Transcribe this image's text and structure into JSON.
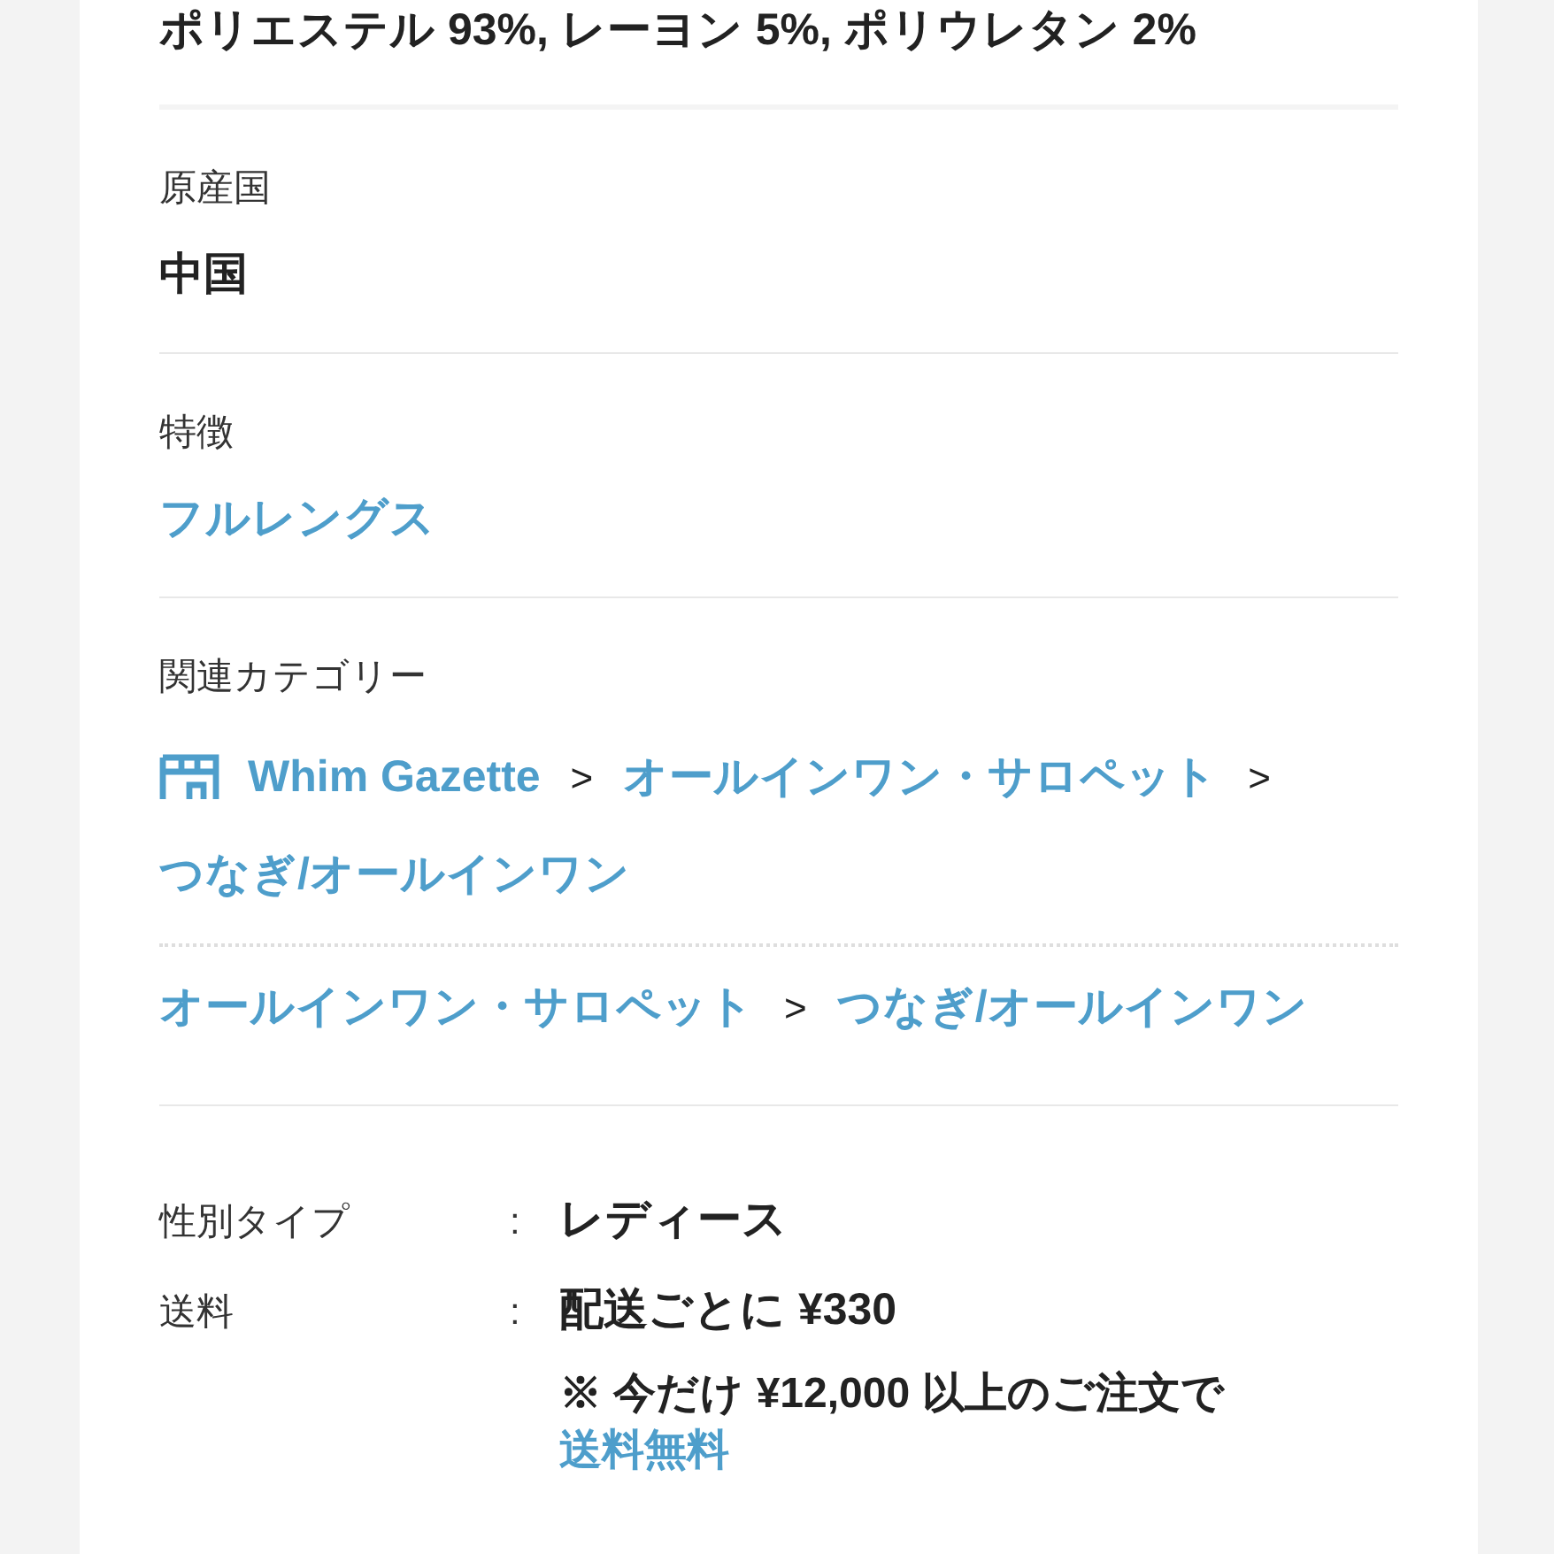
{
  "sections": [
    {
      "kind": "text",
      "value": "ポリエステル 93%, レーヨン 5%, ポリウレタン 2%"
    },
    {
      "kind": "text",
      "label": "原産国",
      "value": "中国"
    },
    {
      "kind": "link",
      "label": "特徴",
      "value": "フルレングス"
    },
    {
      "kind": "categories",
      "label": "関連カテゴリー",
      "paths": [
        {
          "items": [
            {
              "kind": "store",
              "label": "Whim Gazette"
            },
            {
              "kind": "separator",
              "label": ">"
            },
            {
              "kind": "category",
              "label": "オールインワン・サロペット"
            },
            {
              "kind": "separator",
              "label": ">"
            },
            {
              "kind": "category",
              "label": "つなぎ/オールインワン"
            }
          ]
        },
        {
          "items": [
            {
              "kind": "category",
              "label": "オールインワン・サロペット"
            },
            {
              "kind": "separator",
              "label": ">"
            },
            {
              "kind": "category",
              "label": "つなぎ/オールインワン"
            }
          ]
        }
      ]
    },
    {
      "kind": "specs",
      "rows": [
        {
          "label": "性別タイプ",
          "separator": ":",
          "value": "レディース"
        },
        {
          "label": "送料",
          "separator": ":",
          "value": "配送ごとに ¥330",
          "note": "※ 今だけ ¥12,000 以上のご注文で",
          "note_link": "送料無料"
        }
      ]
    }
  ]
}
